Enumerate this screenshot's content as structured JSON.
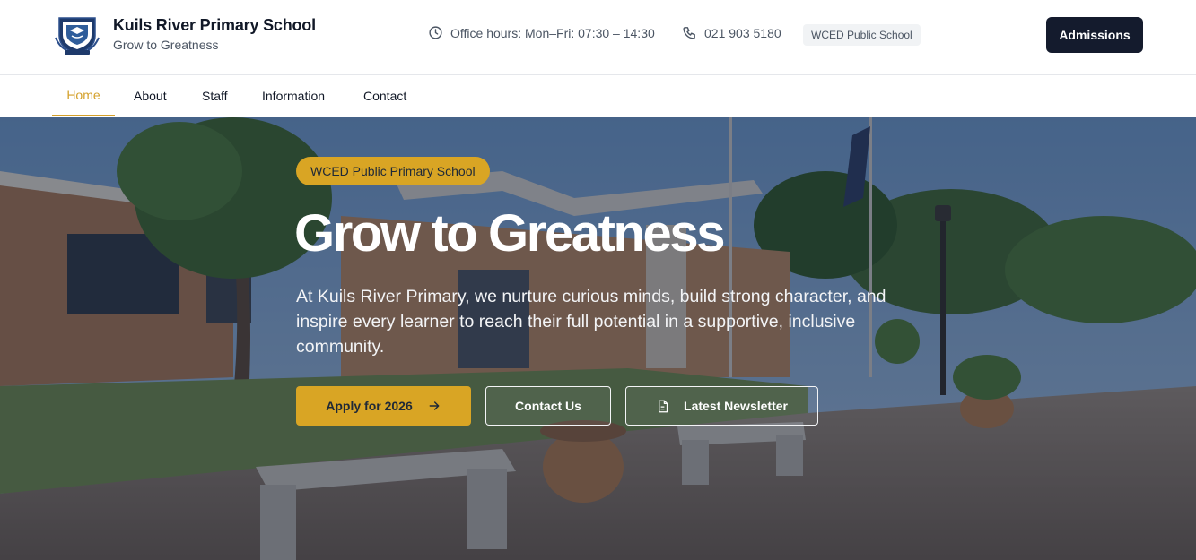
{
  "header": {
    "school_name": "Kuils River Primary School",
    "tagline": "Grow to Greatness",
    "office_hours": "Office hours: Mon–Fri: 07:30 – 14:30",
    "phone": "021 903 5180",
    "badge": "WCED Public School",
    "cta": "Admissions"
  },
  "nav": {
    "items": [
      {
        "label": "Home",
        "active": true
      },
      {
        "label": "About"
      },
      {
        "label": "Staff"
      },
      {
        "label": "Information"
      },
      {
        "label": "Contact"
      }
    ]
  },
  "hero": {
    "pill": "WCED Public Primary School",
    "title": "Grow to Greatness",
    "lead": "At Kuils River Primary, we nurture curious minds, build strong character, and inspire every learner to reach their full potential in a supportive, inclusive community.",
    "buttons": {
      "apply": "Apply for 2026",
      "contact": "Contact Us",
      "newsletter": "Latest Newsletter"
    }
  },
  "icons": {
    "crest": "school-crest-icon",
    "hours": "clock-icon",
    "phone": "phone-icon",
    "apply_arrow": "arrow-right-icon",
    "newsletter": "document-icon"
  },
  "colors": {
    "accent": "#d9a524",
    "nav_active": "#d4a02a",
    "dark": "#141b2d"
  }
}
